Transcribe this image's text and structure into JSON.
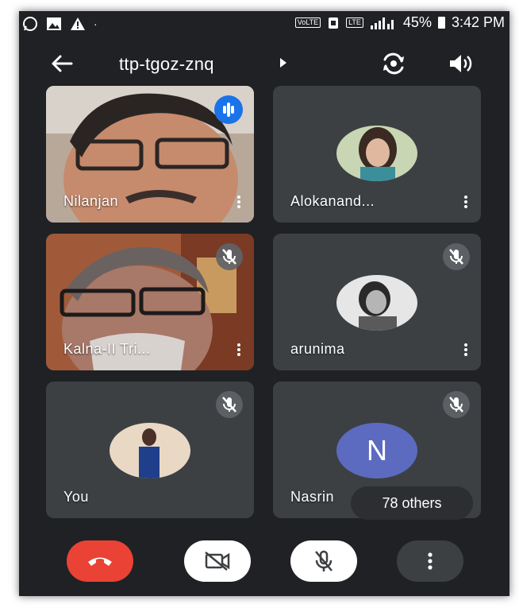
{
  "status_bar": {
    "left_icons": [
      "whatsapp-icon",
      "gallery-icon",
      "warning-icon"
    ],
    "network_labels": [
      "VoLTE",
      "LTE"
    ],
    "battery": "45%",
    "time": "3:42 PM"
  },
  "header": {
    "meeting_code": "ttp-tgoz-znq",
    "icons": [
      "back-arrow-icon",
      "expand-arrow-icon",
      "switch-camera-icon",
      "speaker-icon"
    ]
  },
  "participants": [
    {
      "name": "Nilanjan",
      "speaking": true,
      "muted": false,
      "video": true
    },
    {
      "name": "Alokanand...",
      "speaking": false,
      "muted": false,
      "video": false
    },
    {
      "name": "Kalna-II Tri...",
      "speaking": false,
      "muted": true,
      "video": true
    },
    {
      "name": "arunima",
      "speaking": false,
      "muted": true,
      "video": false
    },
    {
      "name": "You",
      "speaking": false,
      "muted": true,
      "video": false
    },
    {
      "name": "Nasrin",
      "speaking": false,
      "muted": true,
      "video": false,
      "initial": "N"
    }
  ],
  "others_pill": "78 others",
  "controls": [
    "end-call-icon",
    "camera-off-icon",
    "mic-off-icon",
    "more-vert-icon"
  ],
  "colors": {
    "background": "#202124",
    "tile": "#3c4043",
    "active_outline": "#8ab4f8",
    "speaking_badge": "#1a73e8",
    "end_call": "#ea4335",
    "avatar_initial": "#5c6bc0"
  }
}
